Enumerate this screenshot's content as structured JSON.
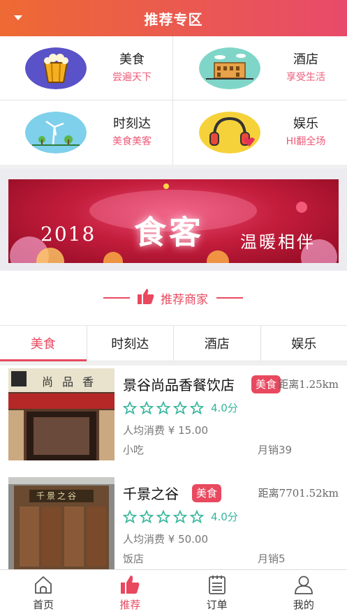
{
  "header": {
    "title": "推荐专区"
  },
  "categories": [
    {
      "name": "美食",
      "sub": "尝遍天下",
      "icon": "popcorn-icon"
    },
    {
      "name": "酒店",
      "sub": "享受生活",
      "icon": "hotel-building-icon"
    },
    {
      "name": "时刻达",
      "sub": "美食美客",
      "icon": "windmill-icon"
    },
    {
      "name": "娱乐",
      "sub": "HI翻全场",
      "icon": "headphones-icon"
    }
  ],
  "banner": {
    "year": "2018",
    "headline": "食客",
    "slogan": "温暖相伴"
  },
  "section": {
    "title": "推荐商家"
  },
  "tabs": [
    {
      "label": "美食",
      "active": true
    },
    {
      "label": "时刻达",
      "active": false
    },
    {
      "label": "酒店",
      "active": false
    },
    {
      "label": "娱乐",
      "active": false
    }
  ],
  "merchants": [
    {
      "name": "景谷尚品香餐饮店",
      "tag": "美食",
      "distance": "距离1.25km",
      "rating": "4.0分",
      "stars": 5,
      "price": "人均消费 ¥ 15.00",
      "category": "小吃",
      "sales": "月销39",
      "photo_sign": "尚 品 香"
    },
    {
      "name": "千景之谷",
      "tag": "美食",
      "distance": "距离7701.52km",
      "rating": "4.0分",
      "stars": 5,
      "price": "人均消费 ¥ 50.00",
      "category": "饭店",
      "sales": "月销5",
      "photo_sign": "千景之谷"
    }
  ],
  "tabbar": [
    {
      "label": "首页",
      "icon": "home-icon",
      "active": false
    },
    {
      "label": "推荐",
      "icon": "thumbs-up-icon",
      "active": true
    },
    {
      "label": "订单",
      "icon": "order-list-icon",
      "active": false
    },
    {
      "label": "我的",
      "icon": "user-icon",
      "active": false
    }
  ],
  "colors": {
    "accent": "#e8495f",
    "header_start": "#ee6a34",
    "header_end": "#e84a6a",
    "star": "#35b59b"
  }
}
